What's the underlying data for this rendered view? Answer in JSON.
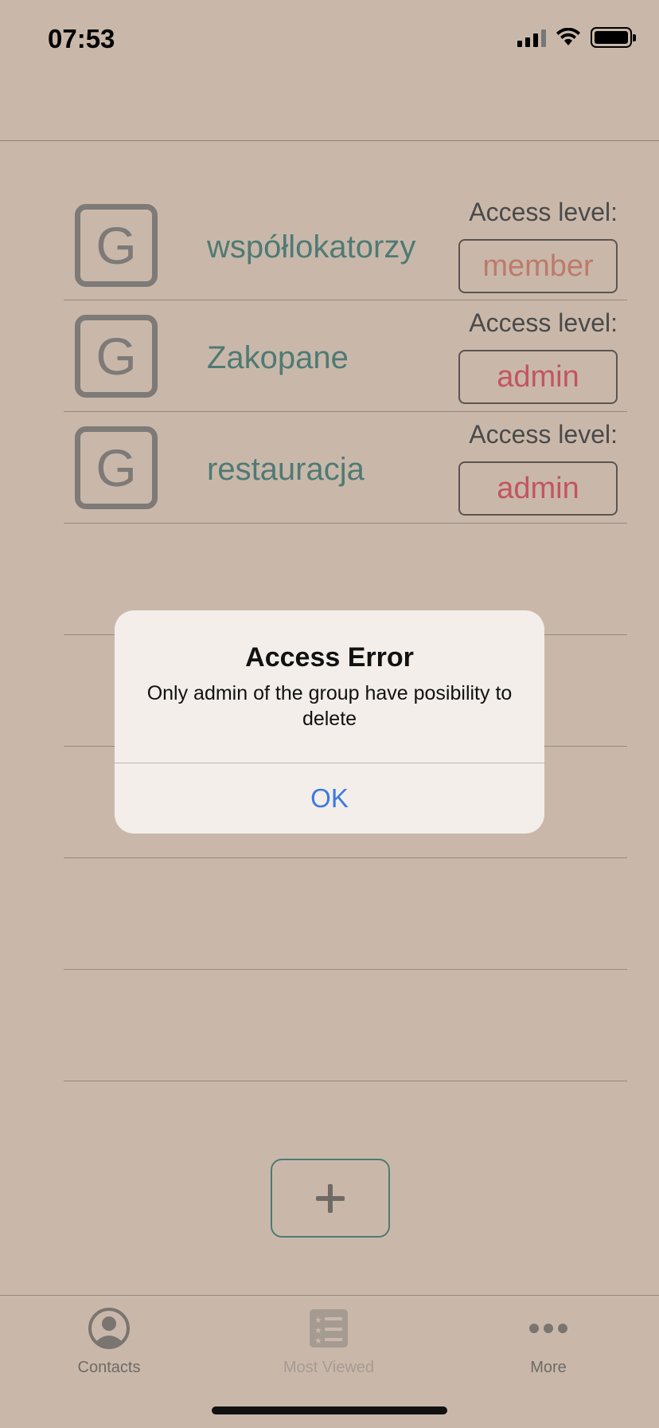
{
  "status": {
    "time": "07:53"
  },
  "groups": [
    {
      "icon_letter": "G",
      "name": "współlokatorzy",
      "access_label": "Access level:",
      "access_value": "member"
    },
    {
      "icon_letter": "G",
      "name": "Zakopane",
      "access_label": "Access level:",
      "access_value": "admin"
    },
    {
      "icon_letter": "G",
      "name": "restauracja",
      "access_label": "Access level:",
      "access_value": "admin"
    }
  ],
  "alert": {
    "title": "Access Error",
    "message": "Only admin of the group have posibility to delete",
    "ok_label": "OK"
  },
  "tabbar": {
    "contacts": "Contacts",
    "most_viewed": "Most Viewed",
    "more": "More"
  },
  "colors": {
    "background": "#c9b8aa",
    "group_name": "#4f7a74",
    "member": "#bd7a6a",
    "admin": "#c2555f",
    "alert_button": "#3b7ae0"
  }
}
